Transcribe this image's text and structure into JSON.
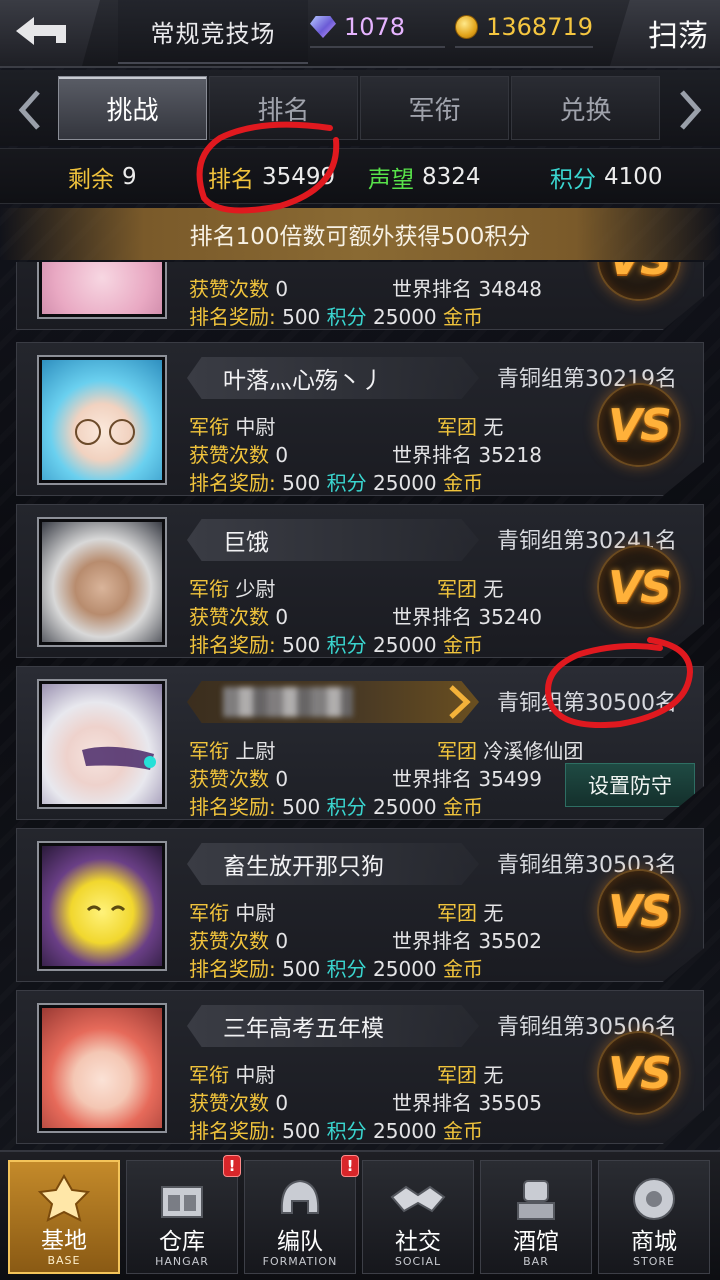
{
  "header": {
    "title": "常规竞技场",
    "gems": "1078",
    "gold": "1368719",
    "sweep_label": "扫荡"
  },
  "tabs": [
    {
      "label": "挑战",
      "active": true
    },
    {
      "label": "排名",
      "active": false
    },
    {
      "label": "军衔",
      "active": false
    },
    {
      "label": "兑换",
      "active": false
    }
  ],
  "stats": {
    "remaining_label": "剩余",
    "remaining_value": "9",
    "rank_label": "排名",
    "rank_value": "35499",
    "prestige_label": "声望",
    "prestige_value": "8324",
    "points_label": "积分",
    "points_value": "4100"
  },
  "bonus_banner": "排名100倍数可额外获得500积分",
  "labels": {
    "military_rank": "军衔",
    "legion": "军团",
    "likes": "获赞次数",
    "world_rank": "世界排名",
    "rank_reward": "排名奖励:",
    "points": "积分",
    "gold": "金币",
    "vs": "VS",
    "set_defense": "设置防守"
  },
  "opponents": [
    {
      "name": "",
      "group_rank": "",
      "mil_rank": "",
      "legion": "",
      "likes": "0",
      "world_rank": "34848",
      "reward_points": "500",
      "reward_gold": "25000",
      "avatar": "pink-hair-girl"
    },
    {
      "name": "叶落灬心殇丶丿",
      "group_rank": "青铜组第30219名",
      "mil_rank": "中尉",
      "legion": "无",
      "likes": "0",
      "world_rank": "35218",
      "reward_points": "500",
      "reward_gold": "25000",
      "avatar": "blue-hair-glasses-girl"
    },
    {
      "name": "巨饿",
      "group_rank": "青铜组第30241名",
      "mil_rank": "少尉",
      "legion": "无",
      "likes": "0",
      "world_rank": "35240",
      "reward_points": "500",
      "reward_gold": "25000",
      "avatar": "old-man-white-hair"
    },
    {
      "name": "",
      "group_rank": "青铜组第30500名",
      "mil_rank": "上尉",
      "legion": "冷溪修仙团",
      "likes": "0",
      "world_rank": "35499",
      "reward_points": "500",
      "reward_gold": "25000",
      "avatar": "white-hair-visor-girl",
      "self": true
    },
    {
      "name": "畜生放开那只狗",
      "group_rank": "青铜组第30503名",
      "mil_rank": "中尉",
      "legion": "无",
      "likes": "0",
      "world_rank": "35502",
      "reward_points": "500",
      "reward_gold": "25000",
      "avatar": "yellow-chick"
    },
    {
      "name": "三年高考五年模",
      "group_rank": "青铜组第30506名",
      "mil_rank": "中尉",
      "legion": "无",
      "likes": "0",
      "world_rank": "35505",
      "reward_points": "500",
      "reward_gold": "25000",
      "avatar": "red-hair-girl"
    }
  ],
  "bottom_nav": [
    {
      "label": "基地",
      "sub": "BASE",
      "icon": "base-emblem-icon",
      "active": true,
      "badge": false
    },
    {
      "label": "仓库",
      "sub": "HANGAR",
      "icon": "hangar-icon",
      "active": false,
      "badge": true
    },
    {
      "label": "编队",
      "sub": "FORMATION",
      "icon": "helmet-icon",
      "active": false,
      "badge": true
    },
    {
      "label": "社交",
      "sub": "SOCIAL",
      "icon": "handshake-icon",
      "active": false,
      "badge": false
    },
    {
      "label": "酒馆",
      "sub": "BAR",
      "icon": "mech-head-icon",
      "active": false,
      "badge": false
    },
    {
      "label": "商城",
      "sub": "STORE",
      "icon": "store-orb-icon",
      "active": false,
      "badge": false
    }
  ],
  "badge_mark": "!",
  "colors": {
    "gold_label": "#f0c33c",
    "cyan_label": "#3ad6d0",
    "green_label": "#58e24a",
    "vs_orange": "#ffb13a",
    "annotation_red": "#e0191f"
  }
}
